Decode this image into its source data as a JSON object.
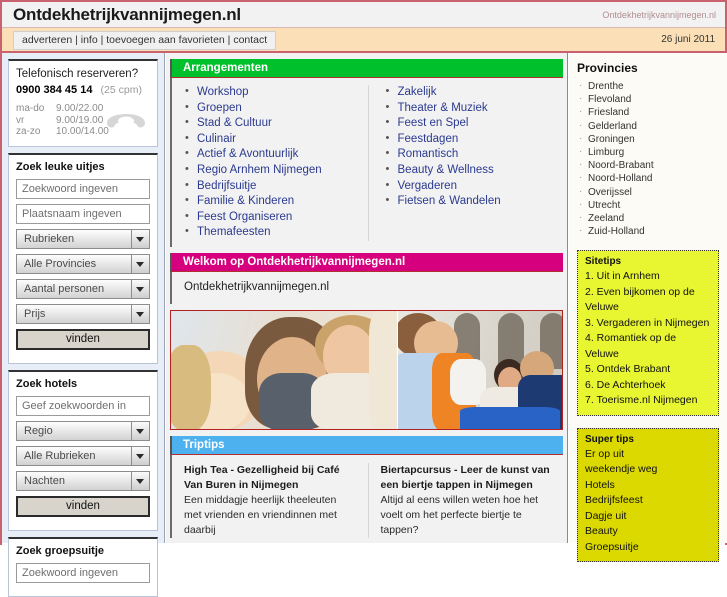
{
  "header": {
    "site_title": "Ontdekhetrijkvannijmegen.nl",
    "site_title_right": "Ontdekhetrijkvannijmegen.nl",
    "nav_links": "adverteren | info | toevoegen aan favorieten | contact",
    "date": "26 juni 2011"
  },
  "phone": {
    "title": "Telefonisch reserveren?",
    "number": "0900 384 45 14",
    "cpm": "(25 cpm)",
    "hours": [
      {
        "days": "ma-do",
        "time": "9.00/22.00"
      },
      {
        "days": "vr",
        "time": "9.00/19.00"
      },
      {
        "days": "za-zo",
        "time": "10.00/14.00"
      }
    ]
  },
  "search_uitjes": {
    "title": "Zoek leuke uitjes",
    "keyword_placeholder": "Zoekwoord ingeven",
    "place_placeholder": "Plaatsnaam ingeven",
    "select_rubrieken": "Rubrieken",
    "select_provincies": "Alle Provincies",
    "select_personen": "Aantal personen",
    "select_prijs": "Prijs",
    "button": "vinden"
  },
  "search_hotels": {
    "title": "Zoek hotels",
    "keyword_placeholder": "Geef zoekwoorden in",
    "select_regio": "Regio",
    "select_rubrieken": "Alle Rubrieken",
    "select_nachten": "Nachten",
    "button": "vinden"
  },
  "search_groepsuitje": {
    "title": "Zoek groepsuitje",
    "keyword_placeholder": "Zoekwoord ingeven"
  },
  "arrangementen": {
    "heading": "Arrangementen",
    "col1": [
      "Workshop",
      "Groepen",
      "Stad & Cultuur",
      "Culinair",
      "Actief & Avontuurlijk",
      "Regio Arnhem Nijmegen",
      "Bedrijfsuitje",
      "Familie & Kinderen",
      "Feest Organiseren",
      "Themafeesten"
    ],
    "col2": [
      "Zakelijk",
      "Theater & Muziek",
      "Feest en Spel",
      "Feestdagen",
      "Romantisch",
      "Beauty & Wellness",
      "Vergaderen",
      "Fietsen & Wandelen"
    ]
  },
  "welkom": {
    "heading": "Welkom op Ontdekhetrijkvannijmegen.nl",
    "text": "Ontdekhetrijkvannijmegen.nl"
  },
  "triptips": {
    "heading": "Triptips",
    "items": [
      {
        "title": "High Tea - Gezelligheid bij Café Van Buren in Nijmegen",
        "body": "Een middagje heerlijk theeleuten met vrienden en vriendinnen met daarbij"
      },
      {
        "title": "Biertapcursus - Leer de kunst van een biertje tappen in Nijmegen",
        "body": "Altijd al eens willen weten hoe het voelt om het perfecte biertje te tappen?"
      }
    ]
  },
  "provincies": {
    "title": "Provincies",
    "items": [
      "Drenthe",
      "Flevoland",
      "Friesland",
      "Gelderland",
      "Groningen",
      "Limburg",
      "Noord-Brabant",
      "Noord-Holland",
      "Overijssel",
      "Utrecht",
      "Zeeland",
      "Zuid-Holland"
    ]
  },
  "sitetips": {
    "title": "Sitetips",
    "items": [
      "1. Uit in Arnhem",
      "2. Even bijkomen op de Veluwe",
      "3. Vergaderen in Nijmegen",
      "4. Romantiek op de Veluwe",
      "5. Ontdek Brabant",
      "6. De Achterhoek",
      "7. Toerisme.nl Nijmegen"
    ]
  },
  "supertips": {
    "title": "Super tips",
    "items": [
      "Er op uit",
      "weekendje weg",
      "Hotels",
      "Bedrijfsfeest",
      "Dagje uit",
      "Beauty",
      "Groepsuitje"
    ]
  },
  "colors": {
    "green": "#00c12b",
    "pink": "#d6007f",
    "blue": "#4db1f0",
    "navbar": "#fbdfb6",
    "border_red": "#c9616f",
    "tip_yellow": "#e8f531",
    "tip_dark_yellow": "#dbd900",
    "link_blue": "#2b3a8f"
  }
}
